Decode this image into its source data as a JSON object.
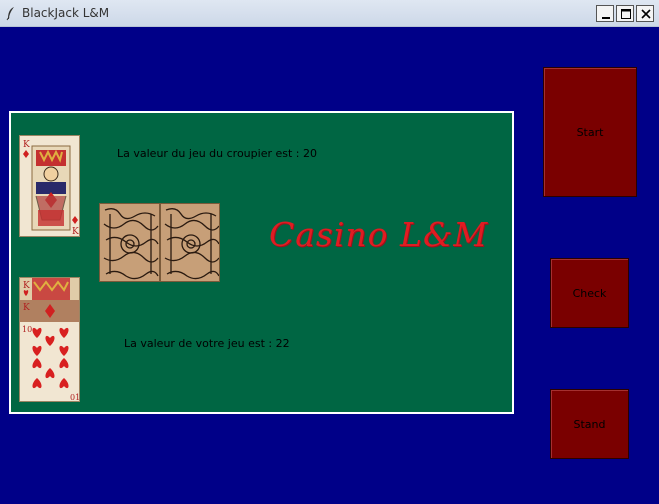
{
  "window": {
    "title": "BlackJack L&M",
    "icon": "feather-icon",
    "controls": [
      "minimize-icon",
      "maximize-icon",
      "close-icon"
    ]
  },
  "table": {
    "dealer_value_text": "La valeur du jeu du croupier est : 20",
    "player_value_text": "La valeur de votre jeu est : 22",
    "logo_text": "Casino  L&M",
    "dealer_cards": [
      {
        "rank": "K",
        "suit": "diamonds"
      }
    ],
    "hidden_cards": [
      "card-back",
      "card-back"
    ],
    "player_cards": [
      {
        "rank": "K",
        "suit": "hearts"
      },
      {
        "rank": "K",
        "suit": "diamonds"
      },
      {
        "rank": "10",
        "suit": "hearts"
      }
    ]
  },
  "buttons": {
    "start": "Start",
    "check": "Check",
    "stand": "Stand"
  },
  "colors": {
    "background": "#000088",
    "felt": "#006643",
    "button": "#7a0000",
    "logo": "#e01c22"
  }
}
